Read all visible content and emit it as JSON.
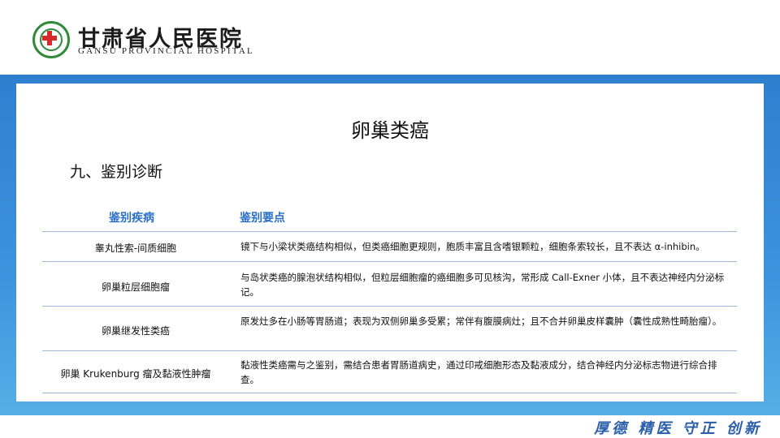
{
  "header": {
    "hospital_cn": "甘肃省人民医院",
    "hospital_en": "GANSU PROVINCIAL HOSPITAL"
  },
  "slide": {
    "title": "卵巢类癌",
    "section": "九、鉴别诊断"
  },
  "table": {
    "headers": [
      "鉴别疾病",
      "鉴别要点"
    ],
    "rows": [
      {
        "disease": "睾丸性索-间质细胞",
        "points": "镜下与小梁状类癌结构相似，但类癌细胞更规则，胞质丰富且含嗜银颗粒，细胞条索较长，且不表达 α-inhibin。"
      },
      {
        "disease": "卵巢粒层细胞瘤",
        "points": "与岛状类癌的腺泡状结构相似，但粒层细胞瘤的癌细胞多可见核沟，常形成 Call-Exner 小体，且不表达神经内分泌标记。"
      },
      {
        "disease": "卵巢继发性类癌",
        "points": "原发灶多在小肠等胃肠道；表现为双侧卵巢多受累；常伴有腹膜病灶；且不合并卵巢皮样囊肿（囊性成熟性畸胎瘤）。"
      },
      {
        "disease": "卵巢 Krukenburg 瘤及黏液性肿瘤",
        "points": "黏液性类癌需与之鉴别，需结合患者胃肠道病史，通过印戒细胞形态及黏液成分，结合神经内分泌标志物进行综合排查。"
      }
    ]
  },
  "footer": {
    "motto": "厚德 精医 守正 创新"
  },
  "colors": {
    "band": "#3f93dd",
    "header_text": "#2a6fc9",
    "logo_green": "#2f8a3a",
    "logo_red": "#d62b2b"
  }
}
